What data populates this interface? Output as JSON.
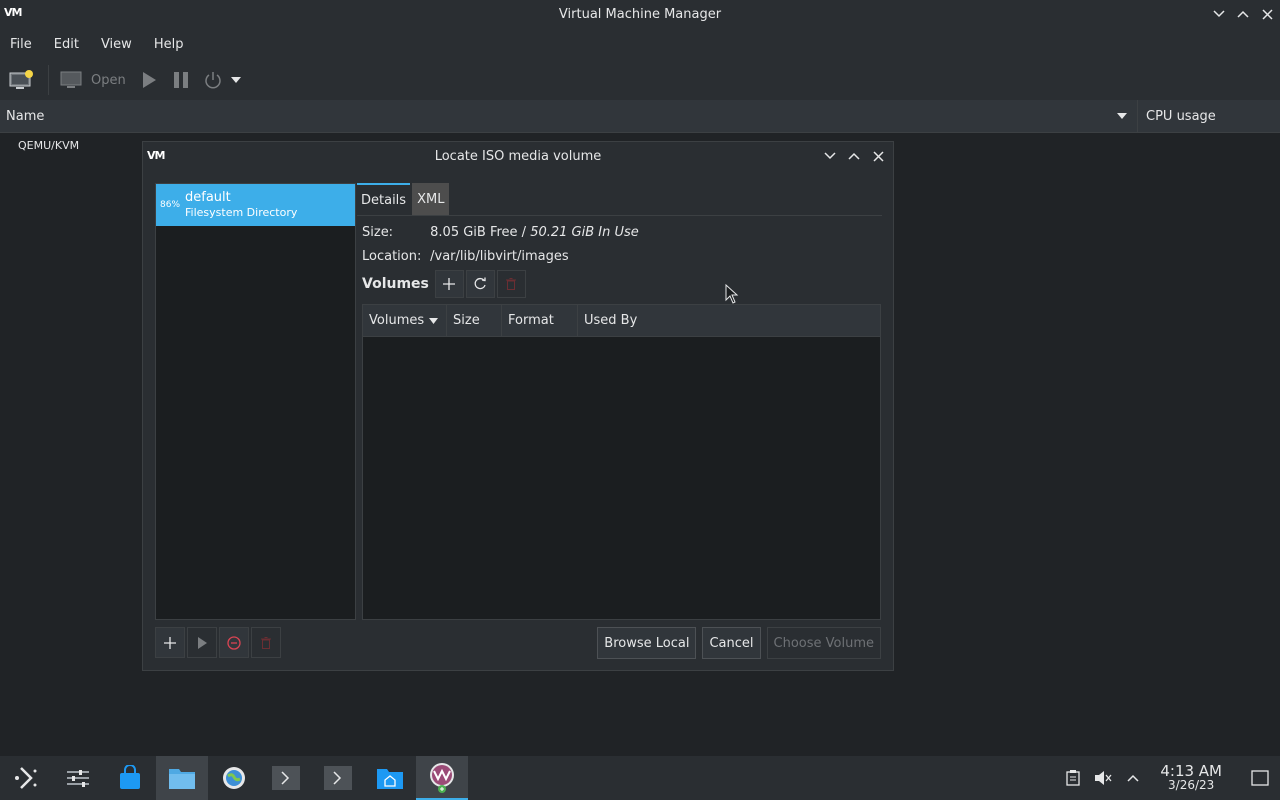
{
  "window": {
    "title": "Virtual Machine Manager",
    "logo": "VM"
  },
  "menu": [
    "File",
    "Edit",
    "View",
    "Help"
  ],
  "toolbar": {
    "open_label": "Open"
  },
  "list": {
    "col_name": "Name",
    "col_cpu": "CPU usage",
    "connection": "QEMU/KVM"
  },
  "dialog": {
    "title": "Locate ISO media volume",
    "pool": {
      "percent": "86%",
      "name": "default",
      "type": "Filesystem Directory"
    },
    "tabs": [
      "Details",
      "XML"
    ],
    "size_label": "Size:",
    "size_free": "8.05 GiB Free",
    "size_sep": " / ",
    "size_used": "50.21 GiB In Use",
    "location_label": "Location:",
    "location_value": "/var/lib/libvirt/images",
    "volumes_label": "Volumes",
    "columns": [
      "Volumes",
      "Size",
      "Format",
      "Used By"
    ],
    "buttons": {
      "browse": "Browse Local",
      "cancel": "Cancel",
      "choose": "Choose Volume"
    }
  },
  "taskbar": {
    "time": "4:13 AM",
    "date": "3/26/23"
  },
  "colors": {
    "accent": "#3daee9",
    "background": "#202326",
    "panel": "#2a2e32"
  }
}
